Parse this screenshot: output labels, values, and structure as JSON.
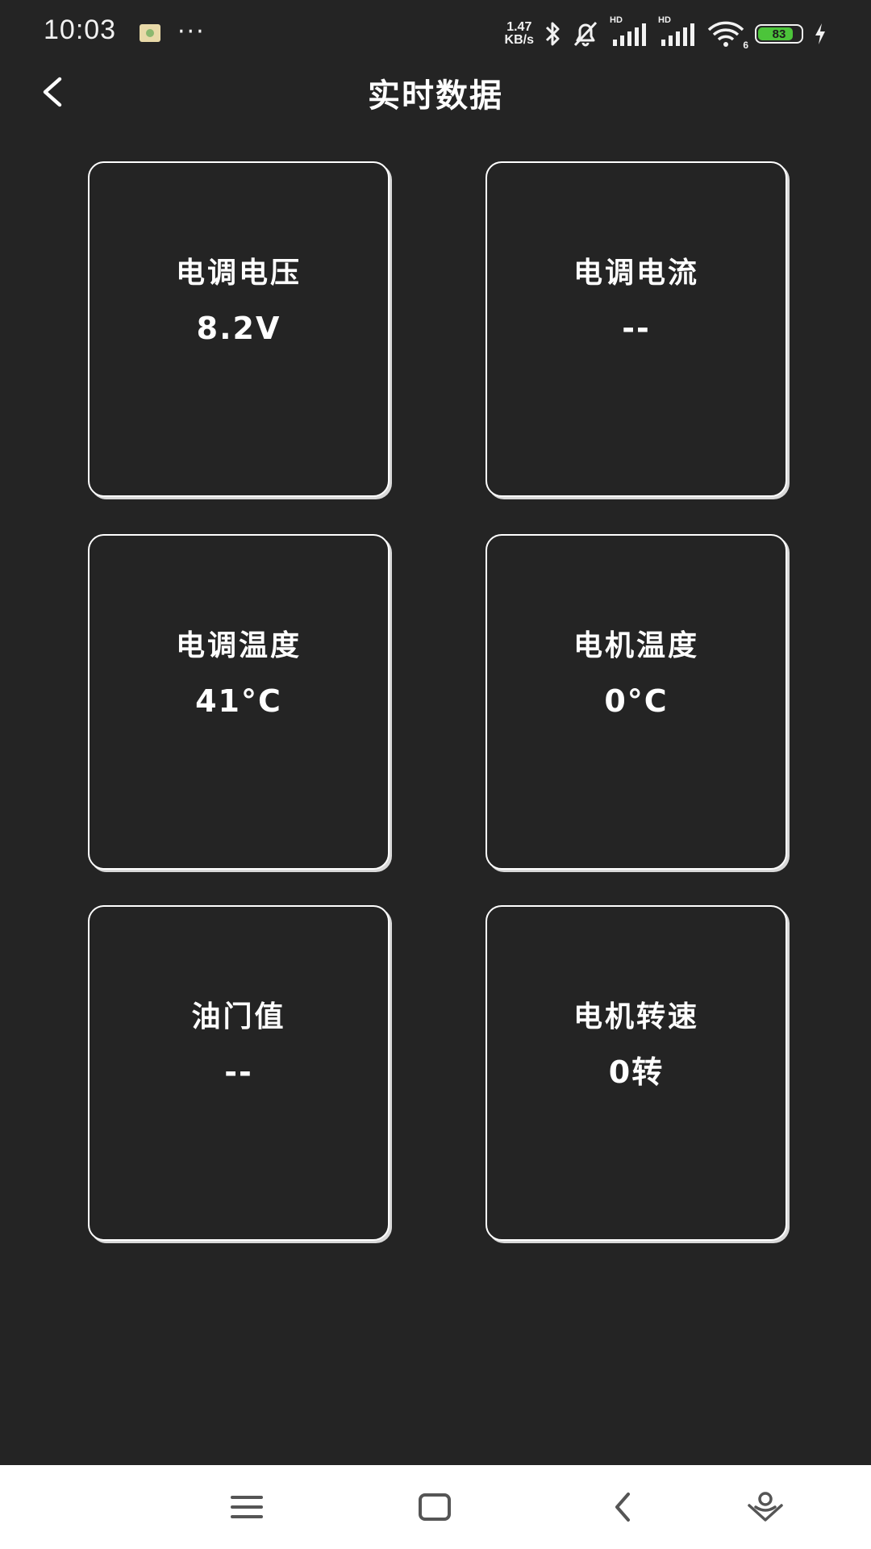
{
  "status_bar": {
    "time": "10:03",
    "more": "···",
    "net_speed_value": "1.47",
    "net_speed_unit": "KB/s",
    "signal_1_label": "HD",
    "signal_2_label": "HD",
    "wifi_label": "6",
    "battery_level": "83",
    "battery_fraction": 0.83,
    "battery_color": "#4cc43a",
    "icons": [
      "gallery-app-icon",
      "bluetooth-icon",
      "muted-bell-icon",
      "cell-signal-icon",
      "cell-signal-icon",
      "wifi-icon",
      "battery-icon",
      "charging-icon"
    ]
  },
  "header": {
    "title": "实时数据",
    "back_icon": "chevron-left-icon"
  },
  "metrics": [
    {
      "label": "电调电压",
      "value": "8.2V"
    },
    {
      "label": "电调电流",
      "value": "--"
    },
    {
      "label": "电调温度",
      "value": "41°C"
    },
    {
      "label": "电机温度",
      "value": "0°C"
    },
    {
      "label": "油门值",
      "value": "--"
    },
    {
      "label": "电机转速",
      "value": "0转"
    }
  ],
  "nav_bar": {
    "icons": [
      "menu-icon",
      "home-icon",
      "back-icon",
      "assistant-icon"
    ]
  },
  "colors": {
    "background": "#242424",
    "text": "#ffffff",
    "card_border": "#ffffff",
    "nav_background": "#ffffff",
    "nav_icon": "#555555"
  }
}
